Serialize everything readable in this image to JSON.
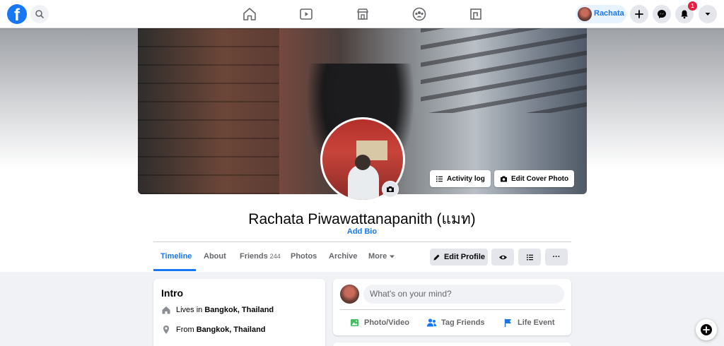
{
  "topbar": {
    "logo": "f",
    "icons": [
      "facebook-logo",
      "search-icon",
      "home-icon",
      "watch-icon",
      "marketplace-icon",
      "groups-icon",
      "gaming-icon",
      "plus-icon",
      "messenger-icon",
      "bell-icon",
      "caret-down-icon"
    ],
    "profile_name": "Rachata",
    "notification_count": "1"
  },
  "cover": {
    "activity_log_label": "Activity log",
    "edit_cover_label": "Edit Cover Photo"
  },
  "profile": {
    "name": "Rachata Piwawattanapanith (แมท)",
    "add_bio": "Add Bio"
  },
  "tabs": [
    {
      "label": "Timeline"
    },
    {
      "label": "About"
    },
    {
      "label": "Friends",
      "count": "244"
    },
    {
      "label": "Photos"
    },
    {
      "label": "Archive"
    },
    {
      "label": "More"
    }
  ],
  "actions": {
    "edit_profile": "Edit Profile",
    "more_dots": "···"
  },
  "intro": {
    "title": "Intro",
    "lives_prefix": "Lives in",
    "lives_value": "Bangkok, Thailand",
    "from_prefix": "From",
    "from_value": "Bangkok, Thailand"
  },
  "composer": {
    "placeholder": "What's on your mind?",
    "photo_video": "Photo/Video",
    "tag_friends": "Tag Friends",
    "life_event": "Life Event"
  },
  "colors": {
    "brand": "#1877f2",
    "badge": "#e41e3f",
    "photo_green": "#45bd62",
    "tag_blue": "#1877f2",
    "event_blue": "#1b74e4"
  }
}
